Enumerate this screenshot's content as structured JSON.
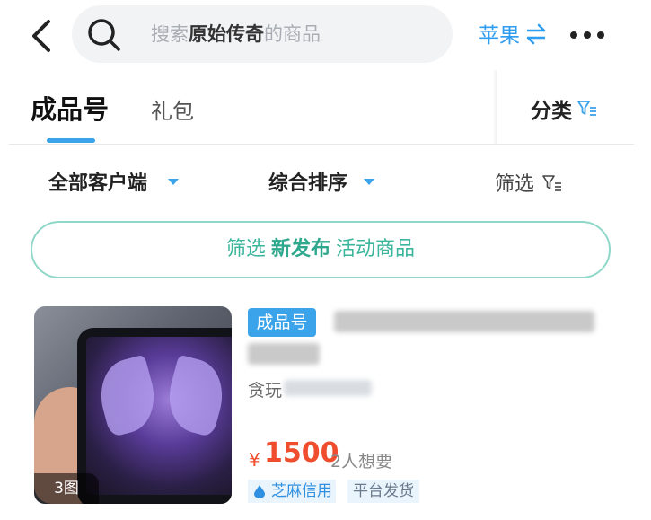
{
  "header": {
    "search_prefix": "搜索",
    "search_keyword": "原始传奇",
    "search_suffix": "的商品",
    "platform_label": "苹果",
    "platform_switch_icon": "swap-icon",
    "more_icon": "more-dots-icon",
    "back_icon": "back-arrow-icon",
    "search_icon": "search-icon"
  },
  "tabs": {
    "active": "成品号",
    "other": "礼包",
    "category_label": "分类"
  },
  "filters": {
    "client": "全部客户端",
    "sort": "综合排序",
    "screen": "筛选"
  },
  "banner": {
    "prefix": "筛选",
    "highlight": "新发布",
    "suffix": "活动商品"
  },
  "product": {
    "tag": "成品号",
    "seller_prefix": "贪玩",
    "picture_count": "3图",
    "price_symbol": "¥",
    "price": "1500",
    "wanted": "2人想要",
    "badges": [
      "芝麻信用",
      "平台发货"
    ]
  },
  "colors": {
    "accent": "#3aa3ea",
    "price": "#ef4d2e",
    "banner_border": "#8fd8c9",
    "banner_text": "#3bb59b"
  }
}
